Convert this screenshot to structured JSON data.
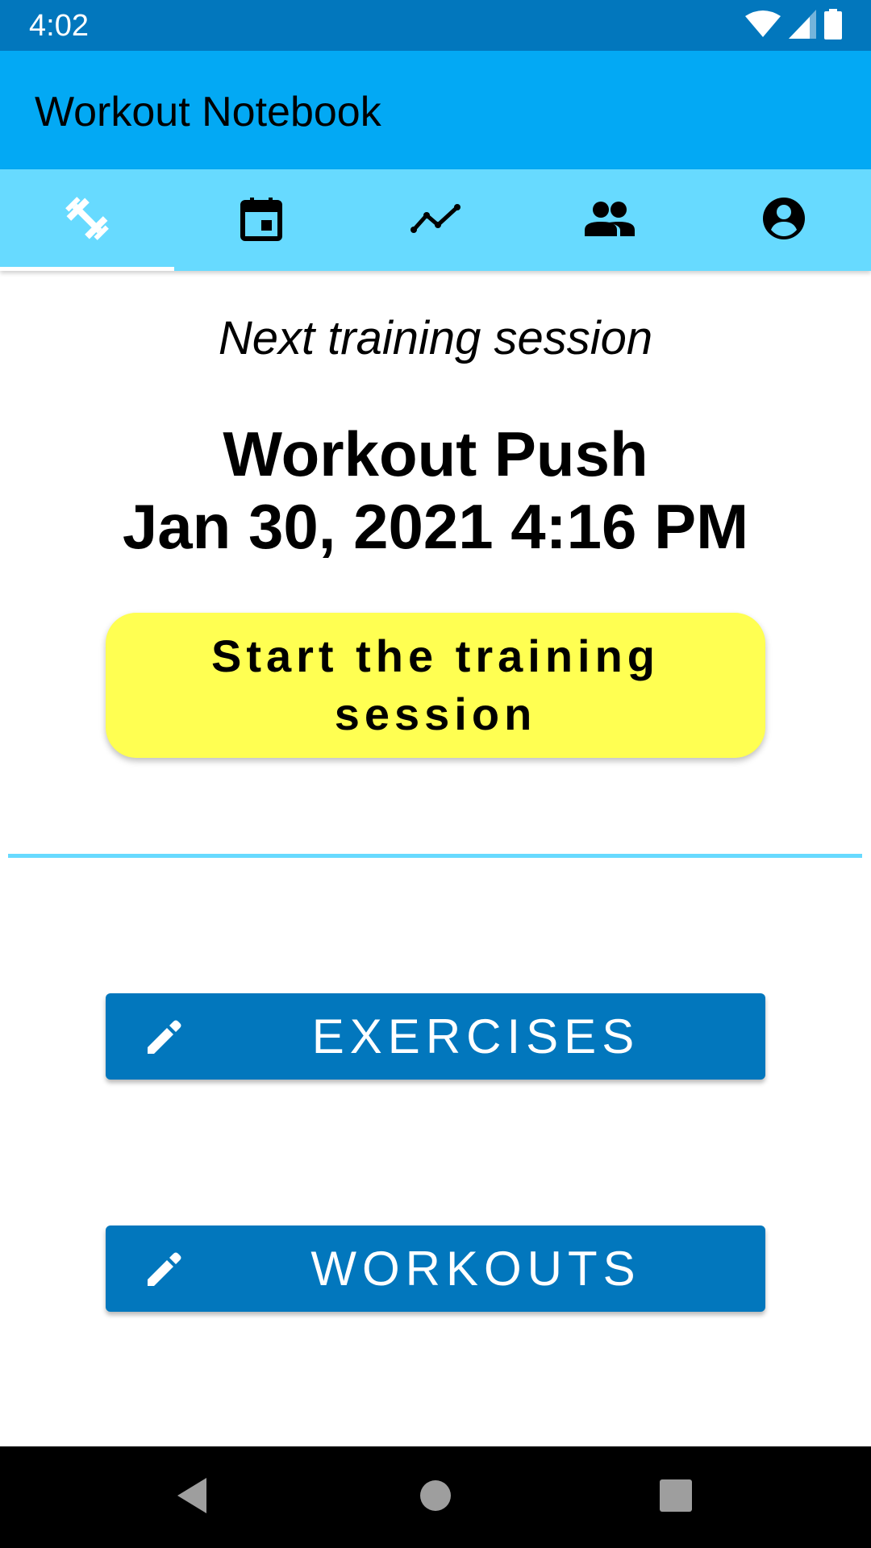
{
  "status_bar": {
    "time": "4:02",
    "icons": [
      "wifi-icon",
      "cellular-signal-icon",
      "battery-icon"
    ]
  },
  "app_bar": {
    "title": "Workout Notebook"
  },
  "tabs": [
    {
      "icon": "dumbbell-icon",
      "selected": true
    },
    {
      "icon": "calendar-icon",
      "selected": false
    },
    {
      "icon": "trending-chart-icon",
      "selected": false
    },
    {
      "icon": "people-icon",
      "selected": false
    },
    {
      "icon": "account-circle-icon",
      "selected": false
    }
  ],
  "main": {
    "next_label": "Next training session",
    "workout_name": "Workout Push",
    "workout_date": "Jan 30, 2021 4:16 PM",
    "start_button_label": "Start the training session",
    "exercises_button_label": "EXERCISES",
    "workouts_button_label": "WORKOUTS"
  },
  "colors": {
    "status_bar": "#0277bd",
    "app_bar": "#03a9f4",
    "tab_bar": "#67daff",
    "start_button": "#ffff52",
    "action_button": "#0277bd",
    "divider": "#67daff",
    "nav_bar": "#000000"
  },
  "nav_bar": {
    "icons": [
      "back-icon",
      "home-icon",
      "recents-icon"
    ]
  }
}
